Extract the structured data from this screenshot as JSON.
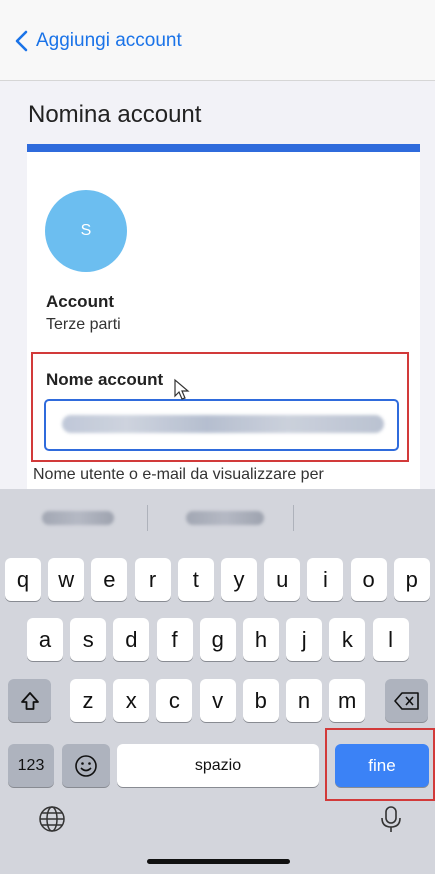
{
  "nav": {
    "back_label": "Aggiungi account"
  },
  "page": {
    "title": "Nomina account"
  },
  "card": {
    "avatar_initial": "S",
    "account_label": "Account",
    "account_value": "Terze parti",
    "name_label": "Nome account",
    "helper_text": "Nome utente o e-mail da visualizzare per"
  },
  "colors": {
    "accent": "#2f6bdc",
    "avatar": "#6cbef0",
    "done_key": "#3b82f6",
    "highlight": "#d23a3a"
  },
  "keyboard": {
    "row1": [
      "q",
      "w",
      "e",
      "r",
      "t",
      "y",
      "u",
      "i",
      "o",
      "p"
    ],
    "row2": [
      "a",
      "s",
      "d",
      "f",
      "g",
      "h",
      "j",
      "k",
      "l"
    ],
    "row3": [
      "z",
      "x",
      "c",
      "v",
      "b",
      "n",
      "m"
    ],
    "numbers_label": "123",
    "space_label": "spazio",
    "done_label": "fine",
    "icons": {
      "shift": "shift-icon",
      "delete": "delete-icon",
      "emoji": "emoji-icon",
      "globe": "globe-icon",
      "mic": "microphone-icon"
    }
  }
}
